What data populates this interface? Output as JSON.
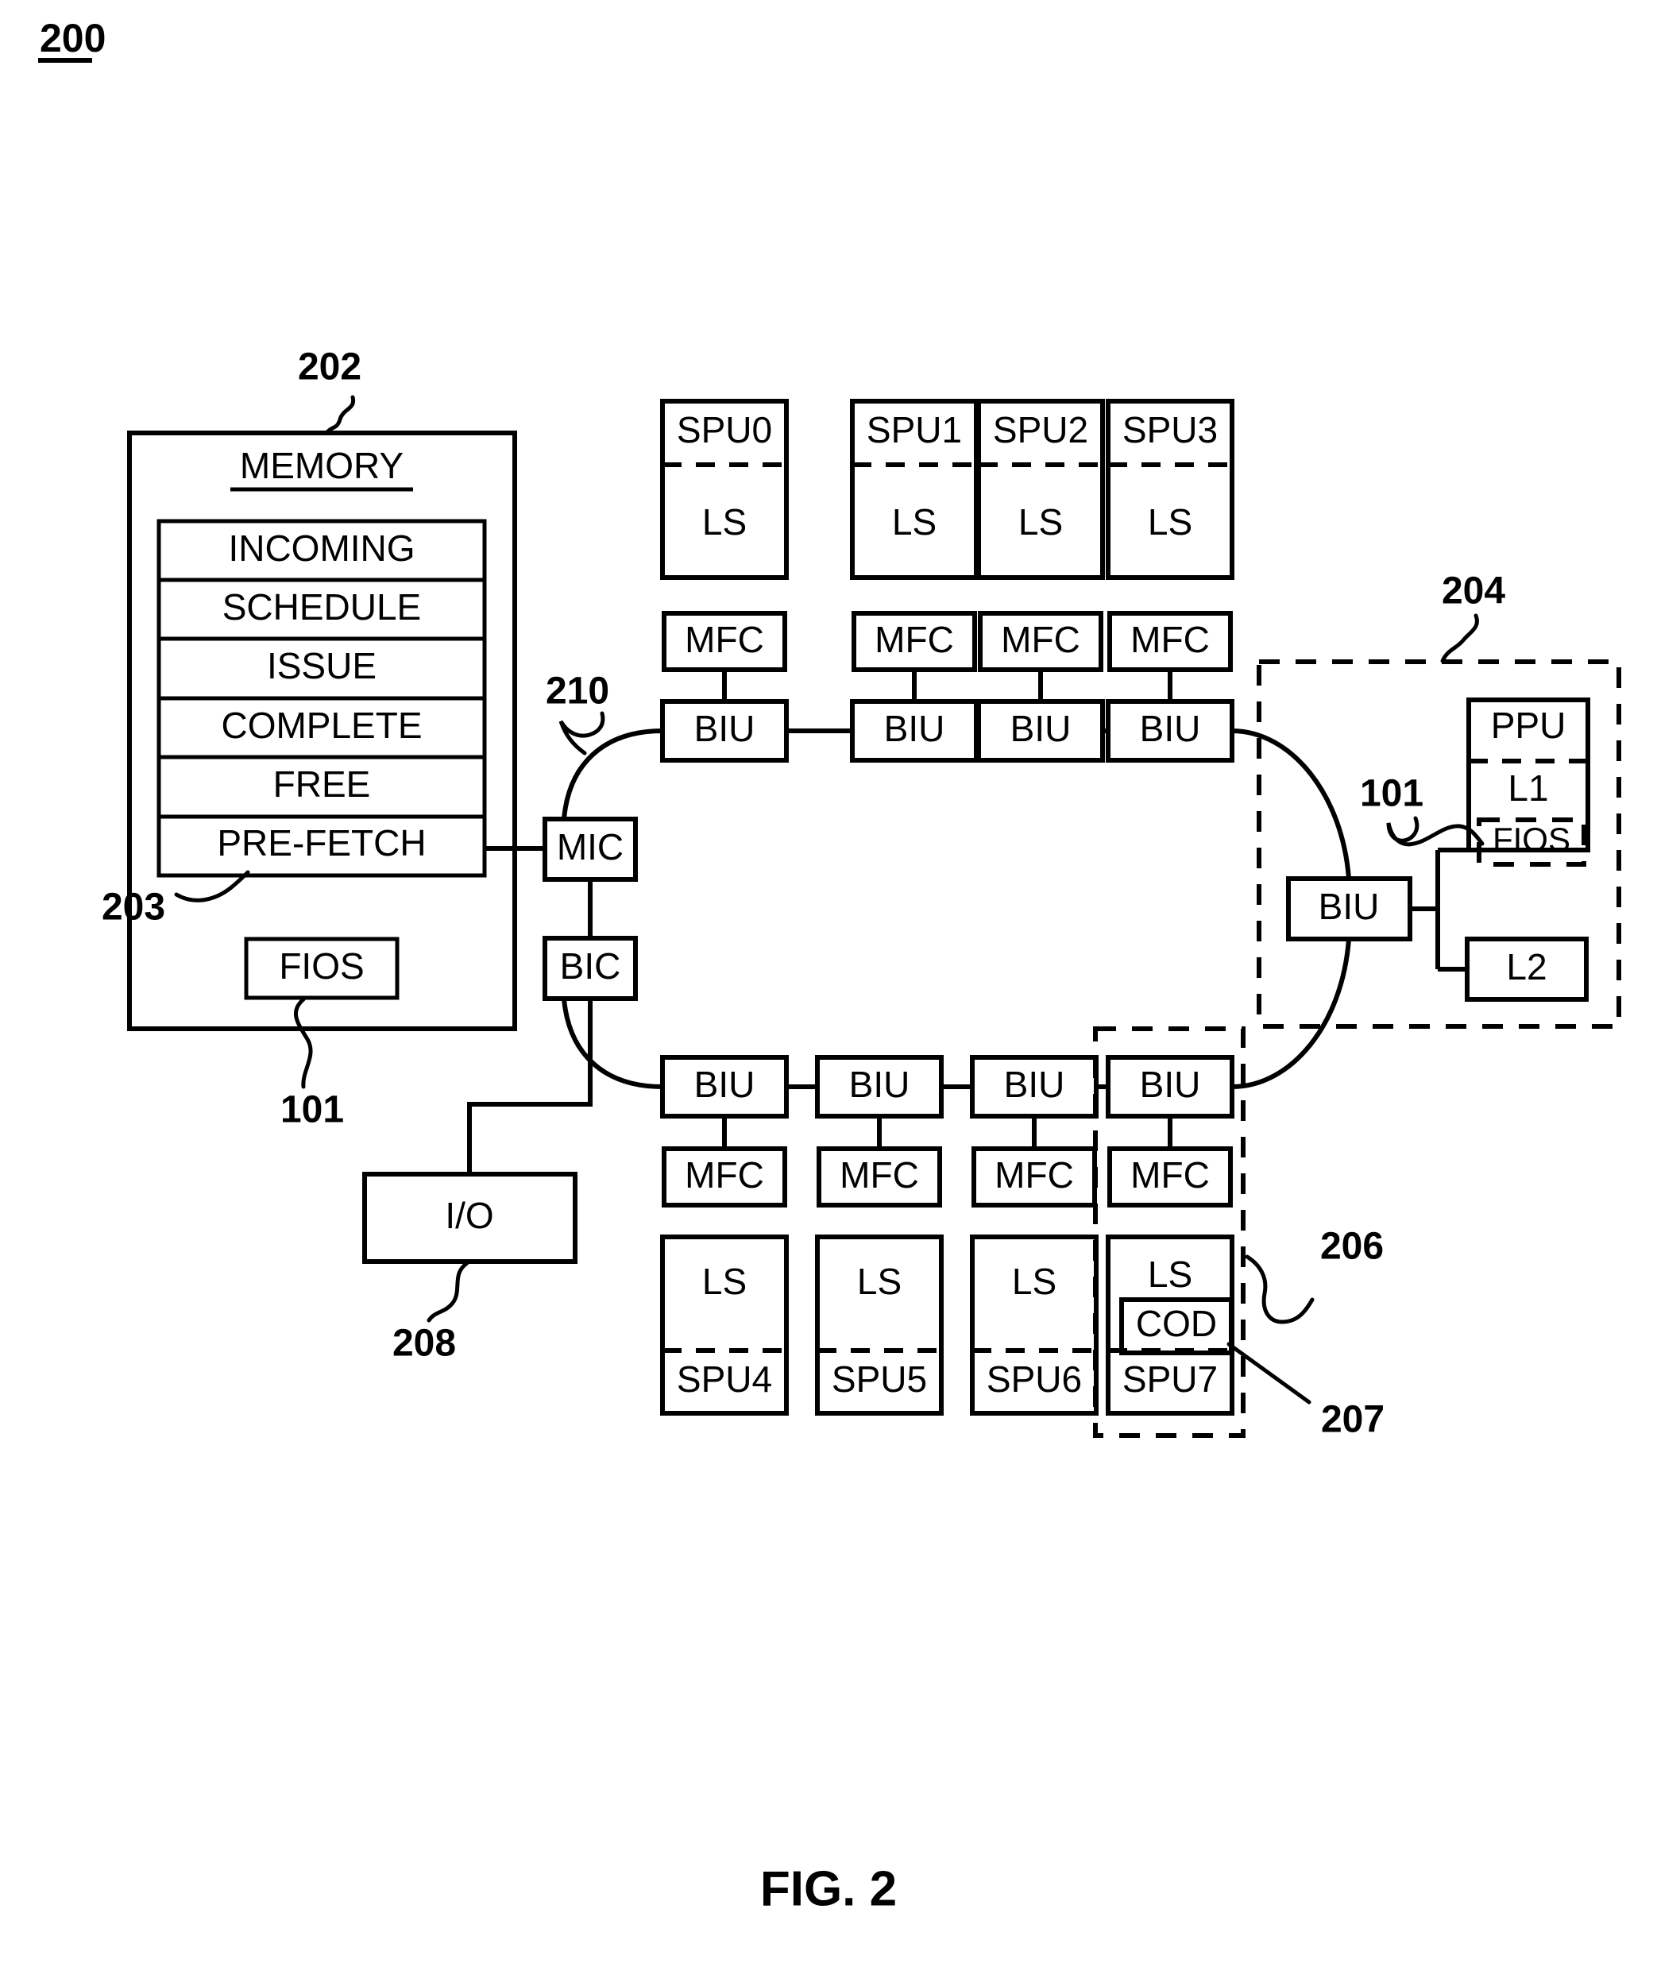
{
  "figure": {
    "number_label": "200",
    "caption": "FIG. 2"
  },
  "memory": {
    "ref": "202",
    "title": "MEMORY",
    "queue_ref": "203",
    "queues": [
      "INCOMING",
      "SCHEDULE",
      "ISSUE",
      "COMPLETE",
      "FREE",
      "PRE-FETCH"
    ],
    "fios_label": "FIOS",
    "fios_ref": "101"
  },
  "bus": {
    "ring_ref": "210",
    "mic_label": "MIC",
    "bic_label": "BIC",
    "io_label": "I/O",
    "io_ref": "208",
    "biu_label": "BIU",
    "mfc_label": "MFC",
    "ls_label": "LS"
  },
  "spu_top": [
    {
      "name": "SPU0",
      "ls": "LS",
      "mfc": "MFC",
      "biu": "BIU"
    },
    {
      "name": "SPU1",
      "ls": "LS",
      "mfc": "MFC",
      "biu": "BIU"
    },
    {
      "name": "SPU2",
      "ls": "LS",
      "mfc": "MFC",
      "biu": "BIU"
    },
    {
      "name": "SPU3",
      "ls": "LS",
      "mfc": "MFC",
      "biu": "BIU"
    }
  ],
  "spu_bottom": [
    {
      "name": "SPU4",
      "ls": "LS",
      "mfc": "MFC",
      "biu": "BIU"
    },
    {
      "name": "SPU5",
      "ls": "LS",
      "mfc": "MFC",
      "biu": "BIU"
    },
    {
      "name": "SPU6",
      "ls": "LS",
      "mfc": "MFC",
      "biu": "BIU"
    },
    {
      "name": "SPU7",
      "ls": "LS",
      "mfc": "MFC",
      "biu": "BIU",
      "cod": "COD"
    }
  ],
  "spu7_group": {
    "ref": "206",
    "cod_ref": "207"
  },
  "ppu_group": {
    "ref": "204",
    "ppu_label": "PPU",
    "l1_label": "L1",
    "fios_label": "FIOS",
    "fios_ref": "101",
    "l2_label": "L2",
    "biu_label": "BIU"
  },
  "colors": {
    "ink": "#000000",
    "paper": "#ffffff"
  }
}
